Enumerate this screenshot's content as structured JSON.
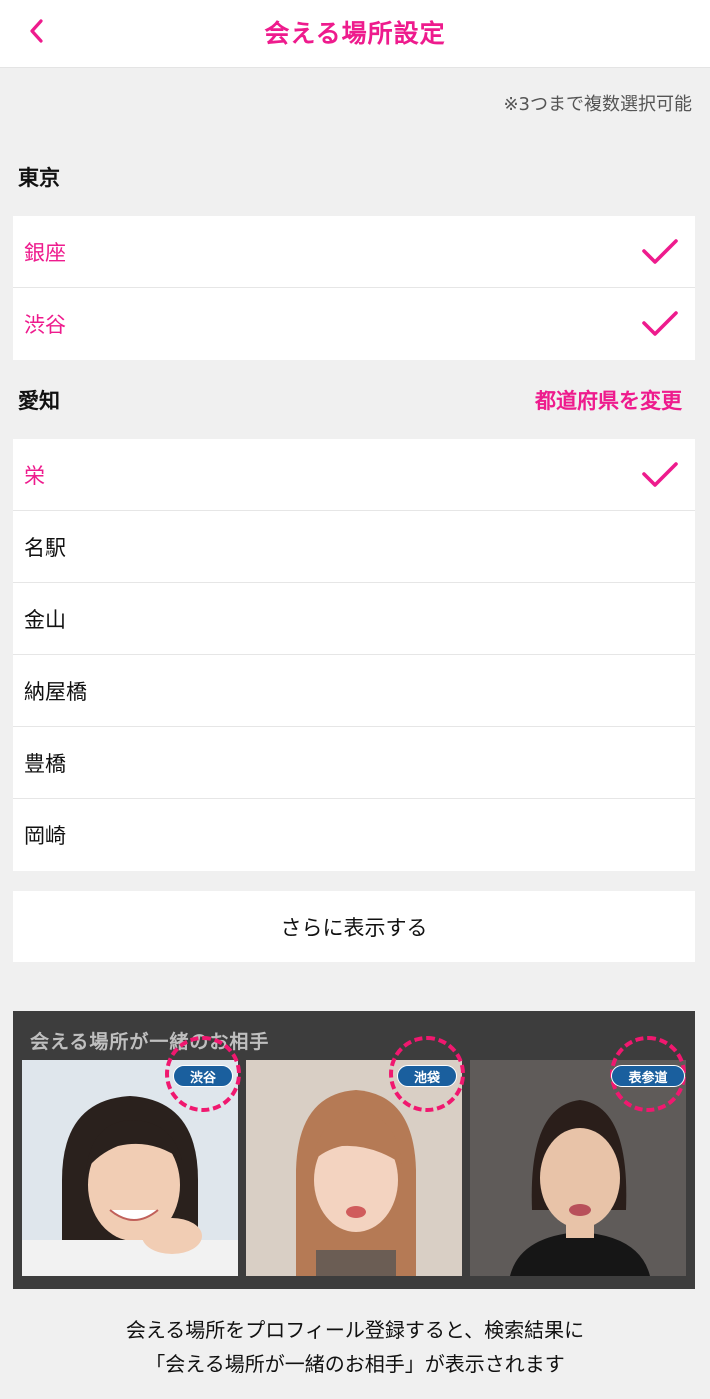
{
  "header": {
    "title": "会える場所設定",
    "back_icon": "chevron-left-icon"
  },
  "note": "※3つまで複数選択可能",
  "sections": [
    {
      "title": "東京",
      "items": [
        {
          "label": "銀座",
          "selected": true
        },
        {
          "label": "渋谷",
          "selected": true
        }
      ]
    },
    {
      "title": "愛知",
      "change_label": "都道府県を変更",
      "items": [
        {
          "label": "栄",
          "selected": true
        },
        {
          "label": "名駅",
          "selected": false
        },
        {
          "label": "金山",
          "selected": false
        },
        {
          "label": "納屋橋",
          "selected": false
        },
        {
          "label": "豊橋",
          "selected": false
        },
        {
          "label": "岡崎",
          "selected": false
        }
      ]
    }
  ],
  "more_button": "さらに表示する",
  "promo": {
    "title": "会える場所が一緒のお相手",
    "badges": [
      "渋谷",
      "池袋",
      "表参道"
    ]
  },
  "footer": {
    "line1": "会える場所をプロフィール登録すると、検索結果に",
    "line2": "「会える場所が一緒のお相手」が表示されます"
  },
  "colors": {
    "accent": "#ee1b8d",
    "badge": "#1a5f9e"
  }
}
